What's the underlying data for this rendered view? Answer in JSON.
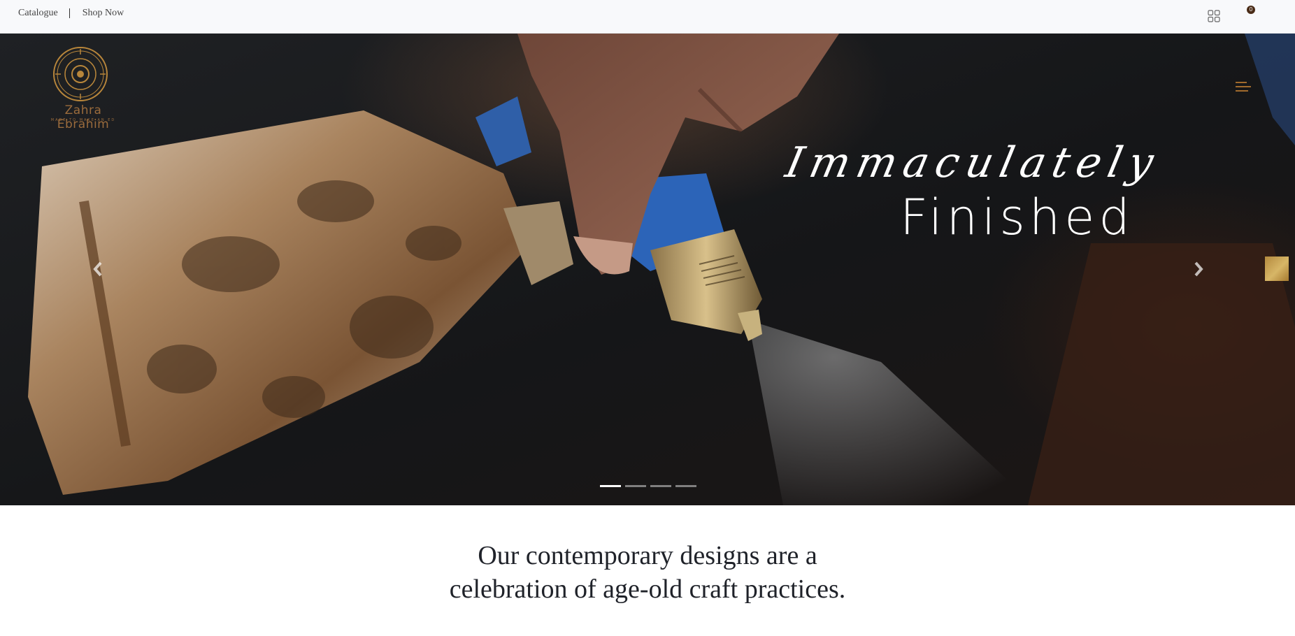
{
  "topbar": {
    "nav": [
      {
        "label": "Catalogue"
      },
      {
        "label": "Shop Now"
      }
    ],
    "grid_icon": "grid-icon",
    "cart_icon": "shopping-bag-icon",
    "cart_count": "0"
  },
  "brand": {
    "name": "Zahra Ebrahim",
    "tagline": "MADE TO MAKE AN ED"
  },
  "hero": {
    "headline_script": "Immaculately",
    "headline_main": "Finished",
    "slide_count": 4,
    "active_slide": 1,
    "prev_icon": "chevron-left-icon",
    "next_icon": "chevron-right-icon",
    "menu_icon": "hamburger-menu-icon"
  },
  "intro": {
    "line1": "Our contemporary designs are a",
    "line2": "celebration of age-old craft practices."
  },
  "colors": {
    "accent_gold": "#b8863b",
    "brand_brown": "#9a6b3c",
    "text_dark": "#1f2229",
    "topbar_bg": "#f8f9fb"
  }
}
